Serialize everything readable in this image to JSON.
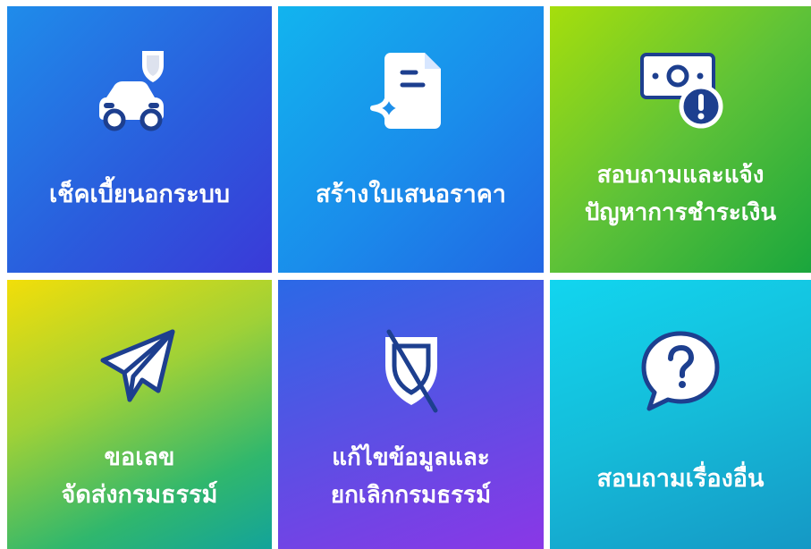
{
  "colors": {
    "icon_stroke": "#ffffff",
    "icon_detail": "#1d3f8f"
  },
  "tiles": [
    {
      "id": "check-tax",
      "icon": "car-shield-icon",
      "label_lines": [
        "เช็คเบี้ยนอกระบบ"
      ]
    },
    {
      "id": "create-quote",
      "icon": "document-sparkle-icon",
      "label_lines": [
        "สร้างใบเสนอราคา"
      ]
    },
    {
      "id": "payment-issue",
      "icon": "money-alert-icon",
      "label_lines": [
        "สอบถามและแจ้ง",
        "ปัญหาการชำระเงิน"
      ]
    },
    {
      "id": "request-policy",
      "icon": "paper-plane-icon",
      "label_lines": [
        "ขอเลข",
        "จัดส่งกรมธรรม์"
      ]
    },
    {
      "id": "edit-cancel",
      "icon": "shield-off-icon",
      "label_lines": [
        "แก้ไขข้อมูลและ",
        "ยกเลิกกรมธรรม์"
      ]
    },
    {
      "id": "other-inquiry",
      "icon": "question-bubble-icon",
      "label_lines": [
        "สอบถามเรื่องอื่น"
      ]
    }
  ]
}
